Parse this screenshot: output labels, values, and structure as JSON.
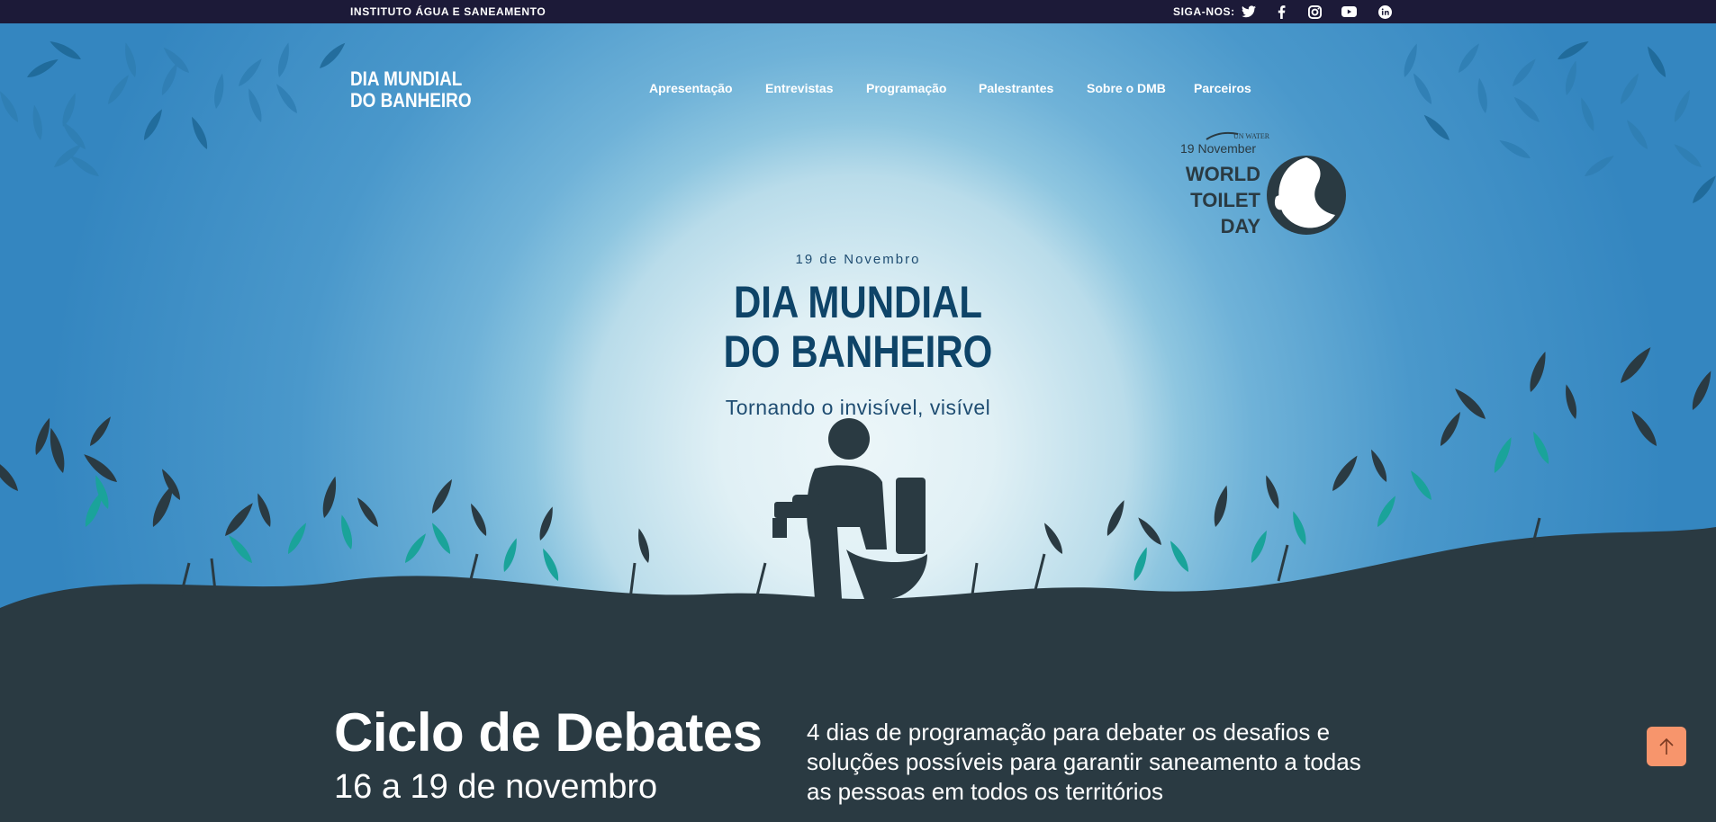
{
  "topbar": {
    "org": "INSTITUTO ÁGUA E SANEAMENTO",
    "follow": "SIGA-NOS:",
    "social": [
      "twitter-icon",
      "facebook-icon",
      "instagram-icon",
      "youtube-icon",
      "linkedin-icon"
    ]
  },
  "header": {
    "brand_line1": "DIA MUNDIAL",
    "brand_line2": "DO BANHEIRO",
    "nav": [
      "Apresentação",
      "Entrevistas",
      "Programação",
      "Palestrantes",
      "Sobre o DMB",
      "Parceiros"
    ]
  },
  "logo": {
    "org": "UN WATER",
    "date": "19 November",
    "line1": "WORLD",
    "line2": "TOILET",
    "line3": "DAY"
  },
  "hero": {
    "date": "19 de Novembro",
    "title_line1": "DIA MUNDIAL",
    "title_line2": "DO BANHEIRO",
    "subtitle": "Tornando o invisível, visível"
  },
  "event": {
    "title": "Ciclo de Debates",
    "dates": "16 a 19 de novembro",
    "description": "4 dias de programação para debater os desafios e soluções possíveis para garantir saneamento a todas as pessoas em todos os territórios"
  },
  "colors": {
    "topbar": "#1c1a38",
    "sky": "#3486c0",
    "dark": "#2a3a42",
    "teal": "#1aa39a",
    "title": "#0e4468",
    "accent": "#f7956c"
  }
}
